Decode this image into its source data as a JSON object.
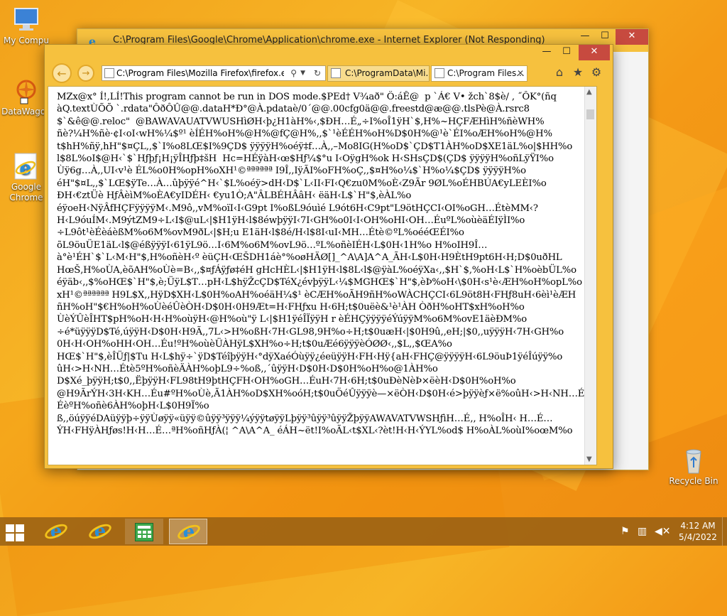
{
  "desktop": {
    "icons": [
      {
        "label": "My Compu"
      },
      {
        "label": "DataWagon"
      },
      {
        "label": "Google Chrome"
      },
      {
        "label": "Recycle Bin"
      }
    ]
  },
  "back_window": {
    "title": "C:\\Program Files\\Google\\Chrome\\Application\\chrome.exe - Internet Explorer (Not Responding)",
    "close_label": "✕",
    "min_label": "—",
    "max_label": "☐"
  },
  "front_window": {
    "address": "C:\\Program Files\\Mozilla Firefox\\firefox.exe",
    "tabs": [
      {
        "label": "C:\\ProgramData\\Mi..."
      },
      {
        "label": "C:\\Program Files..."
      }
    ],
    "close_label": "✕",
    "min_label": "—",
    "max_label": "☐",
    "content_lines": [
      "MZx@x° Í!‚LÍ!This program cannot be run in DOS mode.$PEd† V¾að\" Ö:áÊ@  p `Á€ V• žch`8$è/ , ˝ÔK°(ñq",
      "àQ.textÙÕÕ `.rdata\"ÔðÔÛ@@.dataH*Ð°@À.pdataè/0´@@.00cfg0ä@@.freestd@æ@@.tlsPè@À.rsrc8",
      "$`&ê@@.reloc\"  @BAWAVAUATVWUSHìØH‹þ¿H1àH%‹‚$ÐH…É„÷I%oÎ1ÿH`$‚H%~HÇFÆHìH%ñèWH%",
      "ñè?¼H%ñè·¢I‹oI‹wH%¼$º¹ èÍÉH%oH%@H%@fÇ@H%‚‚$`¹èÉÉH%oH%D$0H%@¹è`ÉI%oÆH%oH%@H%",
      "t$hH%ñÿ‚hH\"$¤ÇL‚‚$`I%o8LŒ$I%9ÇD$ ÿÿÿÿH%oéÿ‡f…À‚‚–Mo8IG(H%oD$`ÇD$T1ÀH%oD$XE1äL%o|$HH%o",
      "l$8L%oI$@H‹`$`Hƒþƒ¡H¡ÿÎHƒþ‡šH  Hc=HÉÿàH‹œ$Hƒ¼$°u I‹OÿgH%ok H‹SHsÇD$(ÇD$ ÿÿÿÿH%oñLÿŸI%o",
      "Ùÿ6g…À‚‚UI‹v¹è ÉL%o0H%opH%oXH¹©ªªªªªª I9Î‚‚IÿÃI%oFH%oÇ‚‚$¤H%o¼$`H%o¼$ÇD$ ÿÿÿÿH%o",
      "éH\"$¤L‚‚$`LŒ$ÿTe…À…ûþÿÿé^H‹`$L%oéÿ>dH‹D$`L‹II‹FI‹Q€zu0M%oÈ‹Z9Ãr 9ØL%oÉHBÚA€yLEÈI%o",
      "ÐH‹€ztÜè HƒÂèìM%oÈA€yIDÉH‹ €yu1Ò;A\"ÂLBÉHÂâH‹ ëäH‹L$`H\"$‚èÀL%o",
      "éÿoeH‹NÿÂfHÇFÿÿÿÿM‹.M9ô‚‚vM%oïI‹I‹G9pt I%oßL9óuìé L9ót6H‹C9pt\"L9ötHÇCI‹OI%oGH…ÉtèMM‹?",
      "H‹L9óuÍM‹.M9ýtZM9÷L‹I$@uL‹|$H1ÿH‹l$8éwþÿÿI‹7I‹GH%o0I‹I‹OH%oHI‹OH…ÉuºL%oùèäÉIÿÌI%o",
      "÷L9ôt¹èÉèáèßM%o6M%ovM9ðL‹|$H;u E1äH‹l$8é/H‹l$8I‹uI‹MH…Étè©ºL%oééŒÉI%o",
      "õL9öuÜE1äL‹l$@éßÿÿÿI‹61ÿL9ö…I‹6M%o6M%ovL9ö…ºL%oñèIÉH‹L$0H‹1H%o H%oIH9Î…",
      "à°è¹ÉH`$`L‹M‹H\"$‚H%oñèH‹º èüÇH‹ŒŠDH1áè°%oøHÄØ[]_^A\\A]A^A_ÃH‹L$0H‹H9ÈtH9pt6H‹H;D$0uðHL",
      "HœŠ‚H%oÙA‚èõAH%oÙè=B‹‚‚$¤ƒÁÿƒø‡éH gHcHÈL‹|$H1ÿH‹l$8L‹l$@ÿàL%oéÿXa‹‚‚$H`$‚%oH‹L$`H%oèbÜL%o",
      "éÿäb‹‚‚$%oHŒ$`H\"$‚è;ÜÿL$T…pH‹L$hÿŽcÇD$TéX¿évþÿÿL‹¼$MGHŒ$`H\"$‚èÞ%oH‹\\$0H‹s¹è‹ÆH%oH%opL%o",
      "xH¹©ªªªªªª H9L$X‚‚HÿD$XH‹L$0H%oAH%oéäH¼$¹ èCÆH%oÃH9ñH%oWÀCHÇCI‹6L9öt8H‹FHƒ8uH‹6èì¹èÆH",
      "ñH%oH\"$€H%oH%oÙèéÛèÒH‹D$0H‹0H9Æt=H‹FHƒxu H‹6H;t$0uëè&¹è¹ÀH ÒðH%oHT$xH%oH%o",
      "ÙèÝÛèÎHT$pH%oH‹H‹H%oùÿH‹@H%où\"ÿ L‹|$H1ÿéÎÏÿÿH r èÉHÇÿÿÿÿéÝúÿÿM%o6M%ovE1äèÐM%o",
      "÷é*üÿÿÿD$Té‚úÿÿH‹D$0H‹H9Ã‚‚7L‹>H%oßH‹7H‹GL98‚9H%o÷H;t$0uæH‹|$0H9û‚‚eH;|$0‚‚uÿÿÿH‹7H‹GH%o",
      "0H‹H‹OH%oHH‹OH…Éu!ºH%oùèÜÀHÿL$XH%o÷H;t$0uÆé6ÿÿÿèÓØØ‹‚‚$L‚‚$ŒA%o",
      "HŒ$`H\"$‚èÎÜƒ|$Tu H‹L$hÿ÷`ÿD$TéîþÿÿH‹°dÿXaéÓùÿÿ¿éeüÿÿH‹FH‹Hÿ{aH‹FHÇ@ÿÿÿÿH‹6L9öuÞ1ÿéÎúÿÿ%o",
      "ûH‹>H‹NH…Étè5ºH%oñèÄÀH%oþL9÷%oß‚‚´ûÿÿH‹D$0H‹D$0H%oH%o@1ÀH%o",
      "D$Xé_þÿÿH;t$0‚‚ËþÿÿH‹FL98tH9þtHÇFH‹OH%oGH…ÉuH‹7H‹6H;t$0uÐèNèÞ×ëèH‹D$0H%oH%o",
      "@H9ÃrÝH‹3H‹KH…Éu#ºH%oÙè‚Ã1ÀH%oD$XH%oóH;t$0uÖéÛÿÿÿè—×ëÒH‹D$0H‹é>þÿÿèƒ×ë%oûH‹>H‹NH…É",
      "ÉèºH%oñè6ÀH%oþH‹L$0H9Ï%o",
      "ß‚‚öúÿÿéDAüÿÿþ÷ÿÿÙøÿÿ«üÿÿ©ûÿÿ³ÿÿÿ¼ýÿÿtøÿÿLþÿÿ³ûÿÿ³ûÿÿŽþÿÿAWAVATVWSHƒìH…É‚‚ H%oÎH‹ H…É…",
      "ÝH‹FHÿÀHƒøs!H‹H…É…ªH%oñHƒÀ(¦ ^A\\A^A_ éÁH~ët!I%oÃL‹t$XL‹?èt!H‹H‹ÝYL%od$ H%oÀL%oùI%oœM%o"
    ]
  },
  "taskbar": {
    "clock_time": "4:12 AM",
    "clock_date": "5/4/2022"
  }
}
